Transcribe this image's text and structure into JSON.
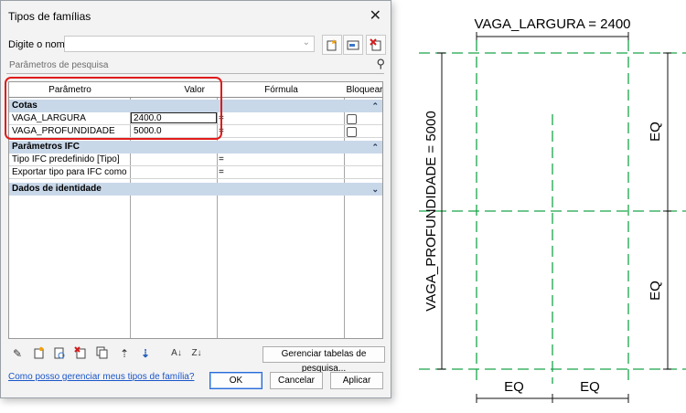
{
  "dialog": {
    "title": "Tipos de famílias",
    "name_label": "Digite o nome:",
    "name_value": "",
    "search_placeholder": "Parâmetros de pesquisa",
    "columns": [
      "Parâmetro",
      "Valor",
      "Fórmula",
      "Bloquear"
    ],
    "groups": [
      {
        "name": "Cotas",
        "chevron": "⌃",
        "rows": [
          {
            "param": "VAGA_LARGURA",
            "value": "2400.0",
            "formula": "=",
            "locked": false
          },
          {
            "param": "VAGA_PROFUNDIDADE",
            "value": "5000.0",
            "formula": "=",
            "locked": false
          }
        ]
      },
      {
        "name": "Parâmetros IFC",
        "chevron": "⌃",
        "rows": [
          {
            "param": "Tipo IFC predefinido [Tipo]",
            "value": "",
            "formula": "=",
            "locked": null
          },
          {
            "param": "Exportar tipo para IFC como",
            "value": "",
            "formula": "=",
            "locked": null
          }
        ]
      },
      {
        "name": "Dados de identidade",
        "chevron": "⌄",
        "rows": []
      }
    ],
    "manage_lookup_label": "Gerenciar tabelas de pesquisa...",
    "help_link": "Como posso gerenciar meus tipos de família?",
    "ok_label": "OK",
    "cancel_label": "Cancelar",
    "apply_label": "Aplicar",
    "icons": [
      "pencil-icon",
      "new-type-icon",
      "rename-type-icon",
      "delete-type-icon",
      "copy-icon",
      "move-up-icon",
      "move-down-icon",
      "sort-ascending-icon",
      "sort-descending-icon"
    ]
  },
  "drawing": {
    "width_label": "VAGA_LARGURA = 2400",
    "depth_label": "VAGA_PROFUNDIDADE = 5000",
    "eq_right_top": "EQ",
    "eq_right_bottom": "EQ",
    "eq_bottom_left": "EQ",
    "eq_bottom_right": "EQ",
    "reference_line_color": "#1aa34a"
  }
}
